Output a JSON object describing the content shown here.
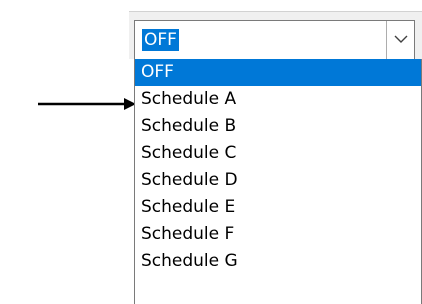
{
  "combobox": {
    "value": "OFF",
    "dropdown_icon": "chevron-down-icon"
  },
  "options": [
    "OFF",
    "Schedule A",
    "Schedule B",
    "Schedule C",
    "Schedule D",
    "Schedule E",
    "Schedule F",
    "Schedule G"
  ],
  "selected_index": 0,
  "annotation": {
    "icon": "pointer-arrow-icon",
    "target": "Schedule A"
  },
  "colors": {
    "selection": "#0078d7",
    "selection_text": "#ffffff",
    "border": "#7a7a7a"
  }
}
